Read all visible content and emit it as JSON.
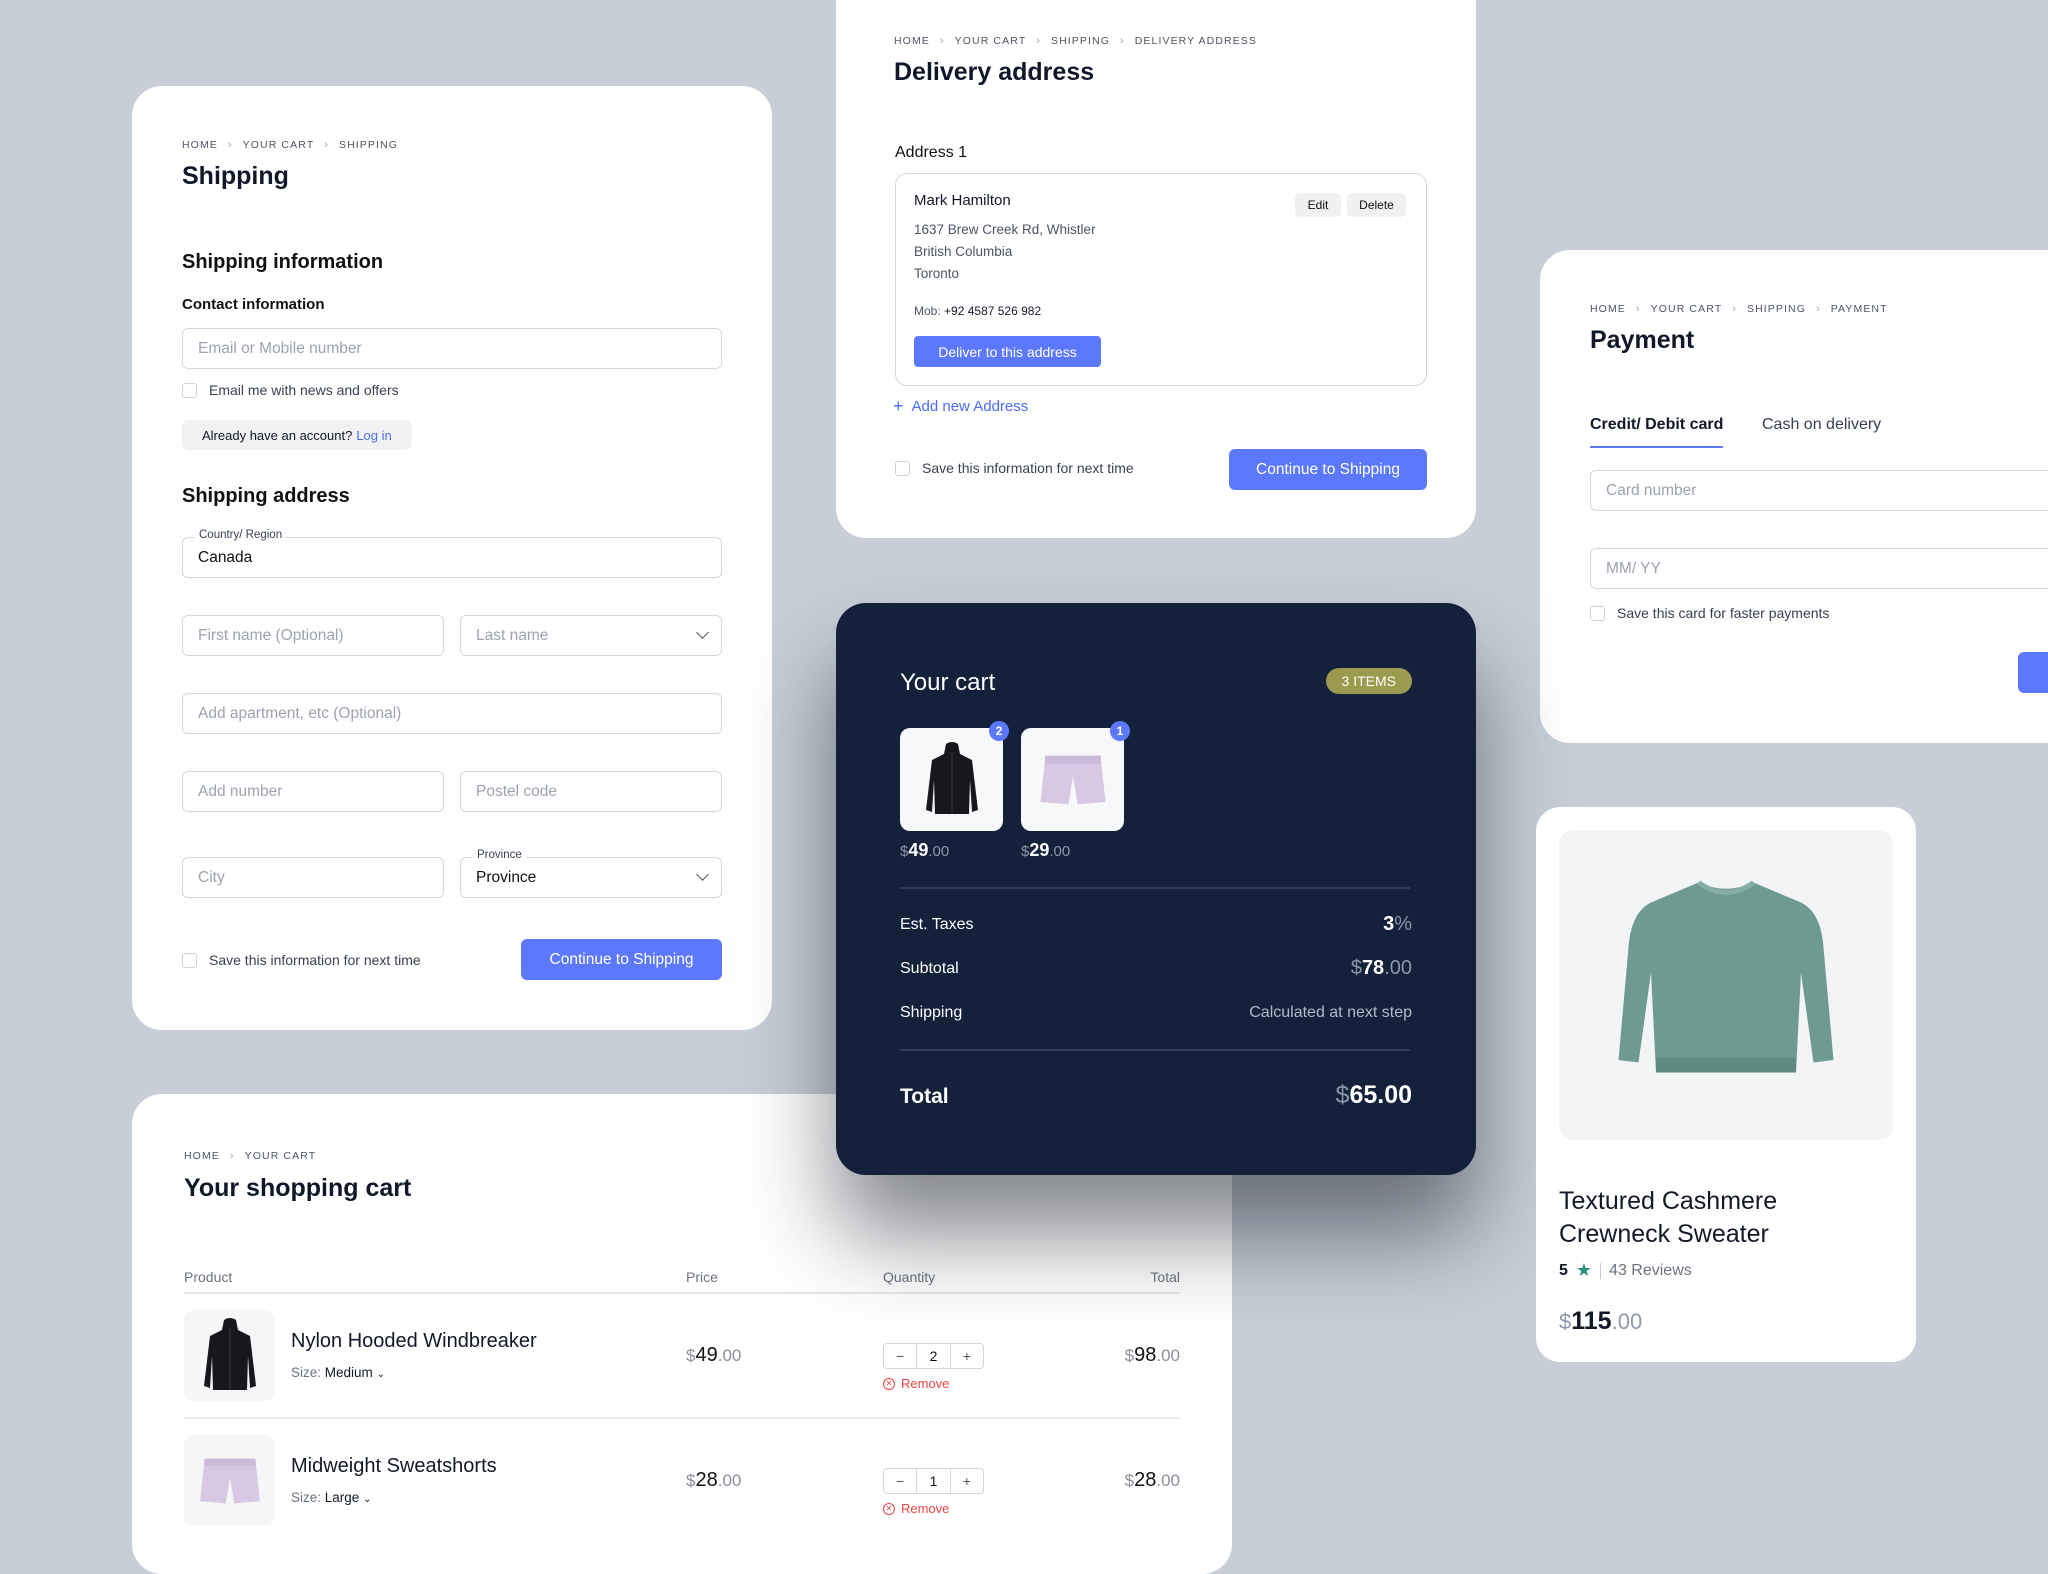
{
  "colors": {
    "accent": "#5b78ff",
    "dark_card": "#13213a",
    "badge": "#9b9a4e",
    "background": "#c7ced8",
    "remove": "#ef4444",
    "star": "#2f8f83"
  },
  "shipping": {
    "breadcrumb": [
      "HOME",
      "YOUR CART",
      "SHIPPING"
    ],
    "title": "Shipping",
    "section_info": "Shipping information",
    "contact_label": "Contact information",
    "email_placeholder": "Email or Mobile number",
    "newsletter_label": "Email me with news and offers",
    "account_text": "Already have an account?",
    "login_link": "Log in",
    "section_address": "Shipping address",
    "country_label": "Country/ Region",
    "country_value": "Canada",
    "first_name_placeholder": "First name (Optional)",
    "last_name_placeholder": "Last name",
    "apartment_placeholder": "Add apartment, etc (Optional)",
    "number_placeholder": "Add number",
    "postal_placeholder": "Postel code",
    "city_placeholder": "City",
    "province_label": "Province",
    "province_value": "Province",
    "save_label": "Save this information for next time",
    "continue_button": "Continue to Shipping"
  },
  "delivery": {
    "breadcrumb": [
      "HOME",
      "YOUR CART",
      "SHIPPING",
      "DELIVERY ADDRESS"
    ],
    "title": "Delivery address",
    "address_label": "Address 1",
    "name": "Mark Hamilton",
    "lines": [
      "1637 Brew Creek Rd, Whistler",
      "British Columbia",
      "Toronto"
    ],
    "mob_label": "Mob:",
    "mob_value": "+92 4587 526 982",
    "edit_button": "Edit",
    "delete_button": "Delete",
    "deliver_button": "Deliver to this address",
    "add_address": "Add new Address",
    "save_label": "Save this information for next time",
    "continue_button": "Continue to Shipping"
  },
  "payment": {
    "breadcrumb": [
      "HOME",
      "YOUR CART",
      "SHIPPING",
      "PAYMENT"
    ],
    "title": "Payment",
    "tabs": [
      {
        "label": "Credit/ Debit card",
        "active": true
      },
      {
        "label": "Cash on delivery",
        "active": false
      }
    ],
    "card_placeholder": "Card number",
    "expiry_placeholder": "MM/ YY",
    "save_card_label": "Save this card for faster payments"
  },
  "cart_summary": {
    "title": "Your cart",
    "items_badge": "3 ITEMS",
    "items": [
      {
        "product": "jacket",
        "qty": "2",
        "currency": "$",
        "whole": "49",
        "cents": ".00"
      },
      {
        "product": "shorts",
        "qty": "1",
        "currency": "$",
        "whole": "29",
        "cents": ".00"
      }
    ],
    "taxes_label": "Est. Taxes",
    "taxes_value": "3",
    "taxes_unit": "%",
    "subtotal_label": "Subtotal",
    "subtotal_currency": "$",
    "subtotal_whole": "78",
    "subtotal_cents": ".00",
    "shipping_label": "Shipping",
    "shipping_value": "Calculated at next step",
    "total_label": "Total",
    "total_currency": "$",
    "total_value": "65.00"
  },
  "shopping_cart": {
    "breadcrumb": [
      "HOME",
      "YOUR CART"
    ],
    "title": "Your shopping cart",
    "columns": [
      "Product",
      "Price",
      "Quantity",
      "Total"
    ],
    "rows": [
      {
        "name": "Nylon Hooded Windbreaker",
        "size_label": "Size:",
        "size": "Medium",
        "price_whole": "49",
        "price_cents": ".00",
        "qty": "2",
        "total_whole": "98",
        "total_cents": ".00",
        "remove": "Remove"
      },
      {
        "name": "Midweight Sweatshorts",
        "size_label": "Size:",
        "size": "Large",
        "price_whole": "28",
        "price_cents": ".00",
        "qty": "1",
        "total_whole": "28",
        "total_cents": ".00",
        "remove": "Remove"
      }
    ],
    "currency": "$"
  },
  "product": {
    "name_line1": "Textured Cashmere",
    "name_line2": "Crewneck Sweater",
    "rating": "5",
    "reviews": "43 Reviews",
    "currency": "$",
    "price_whole": "115",
    "price_cents": ".00"
  }
}
